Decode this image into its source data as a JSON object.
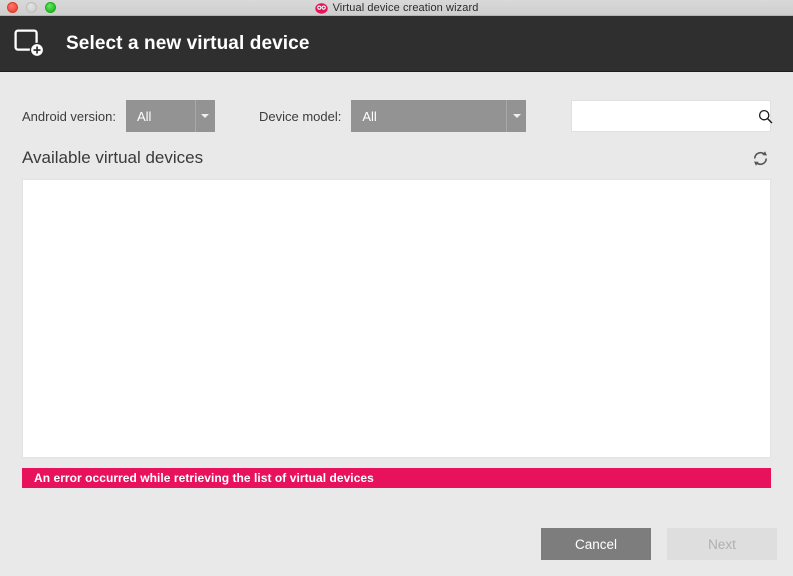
{
  "window": {
    "title": "Virtual device creation wizard",
    "app_icon": "genymotion-logo-icon",
    "controls": {
      "close": "close-window-button",
      "minimize": "minimize-window-button",
      "zoom": "zoom-window-button"
    }
  },
  "header": {
    "title": "Select a new virtual device",
    "icon": "new-device-icon"
  },
  "filters": {
    "android_version": {
      "label": "Android version:",
      "value": "All",
      "options": [
        "All"
      ]
    },
    "device_model": {
      "label": "Device model:",
      "value": "All",
      "options": [
        "All"
      ]
    },
    "search": {
      "value": "",
      "placeholder": "",
      "icon": "search-icon"
    }
  },
  "section": {
    "title": "Available virtual devices",
    "refresh_icon": "refresh-icon"
  },
  "device_list": {
    "items": [],
    "empty": true
  },
  "error": {
    "message": "An error occurred while retrieving the list of virtual devices",
    "color": "#e8125c"
  },
  "footer": {
    "cancel_label": "Cancel",
    "next_label": "Next",
    "next_enabled": false
  },
  "colors": {
    "background": "#e9e9e9",
    "header_bar": "#2f2f2f",
    "dropdown": "#939393",
    "error": "#e8125c",
    "cancel_button": "#7d7d7d",
    "next_button": "#dedede"
  }
}
